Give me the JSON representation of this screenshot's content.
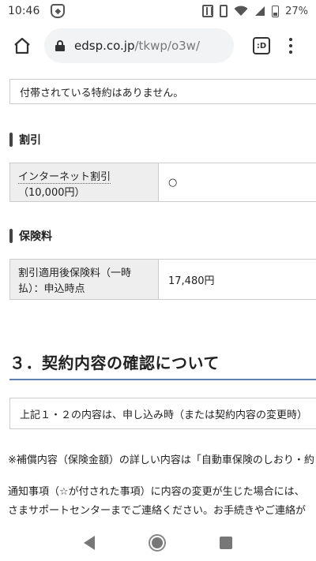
{
  "status_bar": {
    "time": "10:46",
    "battery": "27%"
  },
  "browser": {
    "url_domain": "edsp.co.jp",
    "url_path": "/tkwp/o3w/",
    "tabs_label": ":D"
  },
  "page": {
    "tokuyaku_text": "付帯されている特約はありません。",
    "discount": {
      "heading": "割引",
      "row_label_line1": "インターネット割引",
      "row_label_line2": "（10,000円）",
      "row_value": "○"
    },
    "premium": {
      "heading": "保険料",
      "row_label": "割引適用後保険料（一時払）：申込時点",
      "row_value": "17,480円"
    },
    "section3": {
      "heading": "３．契約内容の確認について",
      "notice": "上記１・２の内容は、申し込み時（または契約内容の変更時）"
    },
    "note1": "※補償内容（保険金額）の詳しい内容は「自動車保険のしおり・約",
    "note2_line1": "通知事項（☆が付された事項）に内容の変更が生じた場合には、",
    "note2_line2": "さまサポートセンターまでご連絡ください。お手続きやご連絡が"
  }
}
